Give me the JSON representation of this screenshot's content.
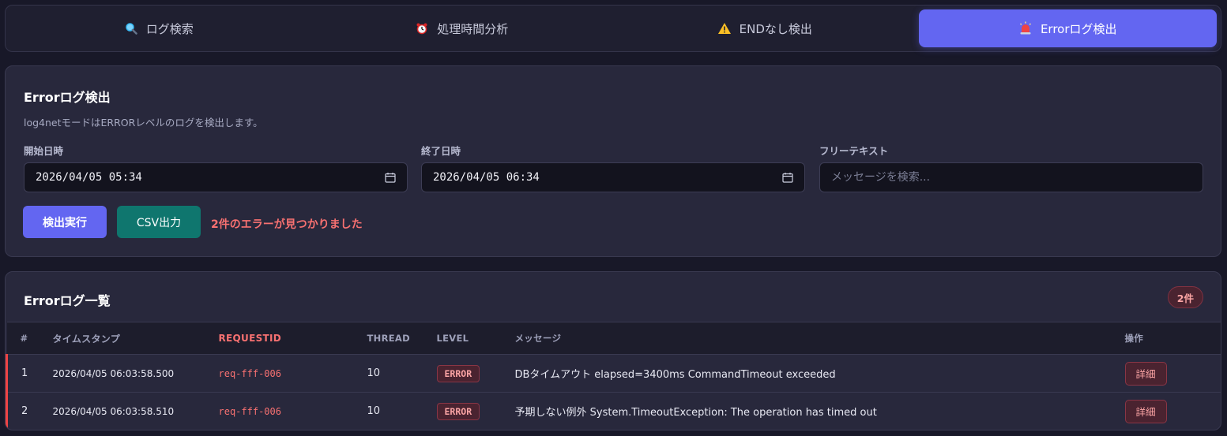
{
  "tabs": [
    {
      "label": "ログ検索",
      "icon": "magnifier-icon",
      "active": false
    },
    {
      "label": "処理時間分析",
      "icon": "alarm-clock-icon",
      "active": false
    },
    {
      "label": "ENDなし検出",
      "icon": "warning-icon",
      "active": false
    },
    {
      "label": "Errorログ検出",
      "icon": "siren-icon",
      "active": true
    }
  ],
  "form": {
    "title": "Errorログ検出",
    "description": "log4netモードはERRORレベルのログを検出します。",
    "start": {
      "label": "開始日時",
      "value": "2026/04/05  05:34"
    },
    "end": {
      "label": "終了日時",
      "value": "2026/04/05  06:34"
    },
    "freetext": {
      "label": "フリーテキスト",
      "placeholder": "メッセージを検索...",
      "value": ""
    },
    "run_label": "検出実行",
    "csv_label": "CSV出力",
    "result_message": "2件のエラーが見つかりました"
  },
  "list": {
    "title": "Errorログ一覧",
    "count_badge": "2件",
    "columns": [
      "#",
      "タイムスタンプ",
      "REQUESTID",
      "THREAD",
      "LEVEL",
      "メッセージ",
      "操作"
    ],
    "rows": [
      {
        "num": "1",
        "timestamp": "2026/04/05 06:03:58.500",
        "request_id": "req-fff-006",
        "thread": "10",
        "level": "ERROR",
        "message": "DBタイムアウト elapsed=3400ms CommandTimeout exceeded",
        "action": "詳細"
      },
      {
        "num": "2",
        "timestamp": "2026/04/05 06:03:58.510",
        "request_id": "req-fff-006",
        "thread": "10",
        "level": "ERROR",
        "message": "予期しない例外 System.TimeoutException: The operation has timed out",
        "action": "詳細"
      }
    ]
  },
  "colors": {
    "accent": "#6366f1",
    "csv_button": "#0f766e",
    "error_text": "#f87171",
    "error_row_marker": "#ef4444"
  }
}
